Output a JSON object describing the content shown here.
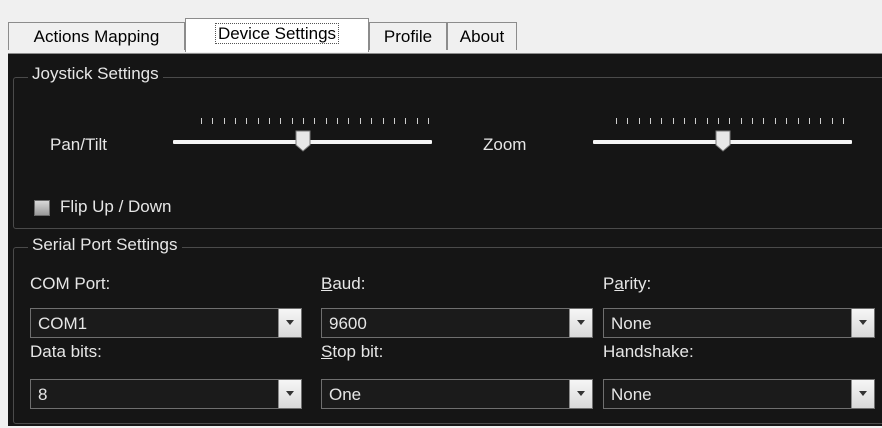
{
  "tabs": [
    {
      "label": "Actions Mapping",
      "active": false
    },
    {
      "label": "Device Settings",
      "active": true
    },
    {
      "label": "Profile",
      "active": false
    },
    {
      "label": "About",
      "active": false
    }
  ],
  "joystick": {
    "title": "Joystick Settings",
    "pan_tilt_label": "Pan/Tilt",
    "pan_tilt_level": 0.5,
    "zoom_label": "Zoom",
    "zoom_level": 0.5,
    "flip_label": "Flip Up / Down",
    "flip_checked": false
  },
  "serial": {
    "title": "Serial Port Settings",
    "com_port": {
      "label": "COM Port:",
      "value": "COM1"
    },
    "baud": {
      "label_mnemonic": "B",
      "label_rest": "aud:",
      "value": "9600"
    },
    "parity": {
      "label_pre": "P",
      "label_mnemonic": "a",
      "label_rest": "rity:",
      "value": "None"
    },
    "data_bits": {
      "label": "Data bits:",
      "value": "8"
    },
    "stop_bit": {
      "label_mnemonic": "S",
      "label_rest": "top bit:",
      "value": "One"
    },
    "handshake": {
      "label": "Handshake:",
      "value": "None"
    }
  },
  "icons": {
    "dropdown": "chevron-down-icon",
    "slider_thumb": "slider-thumb-icon",
    "checkbox": "checkbox-icon"
  }
}
